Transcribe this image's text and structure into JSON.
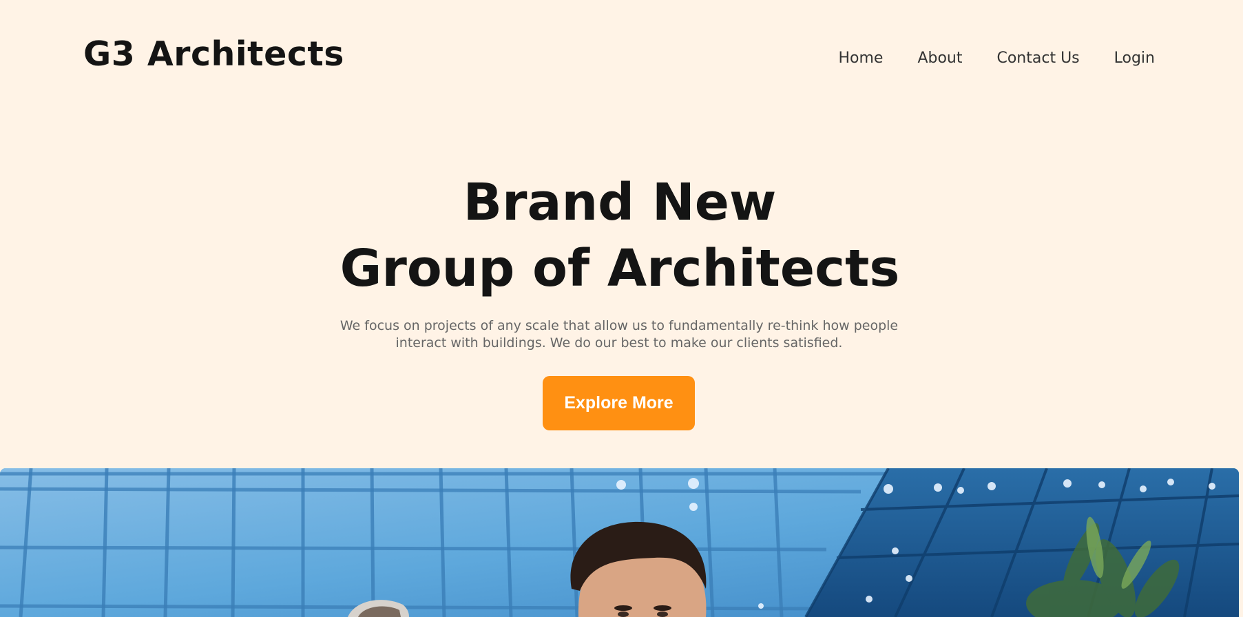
{
  "header": {
    "logo": "G3 Architects",
    "nav": [
      "Home",
      "About",
      "Contact Us",
      "Login"
    ]
  },
  "hero": {
    "title_lines": [
      "Brand New",
      "Group of Architects"
    ],
    "description_lines": [
      "We focus on projects of any scale that allow us to fundamentally re-think how people",
      "interact with buildings. We do our best to make our clients satisfied."
    ],
    "cta_label": "Explore More"
  },
  "colors": {
    "background": "#fff3e6",
    "accent": "#ff9012",
    "heading": "#141414",
    "body_text": "#666666"
  },
  "image": {
    "icon": "photo-architects-glass-building"
  }
}
